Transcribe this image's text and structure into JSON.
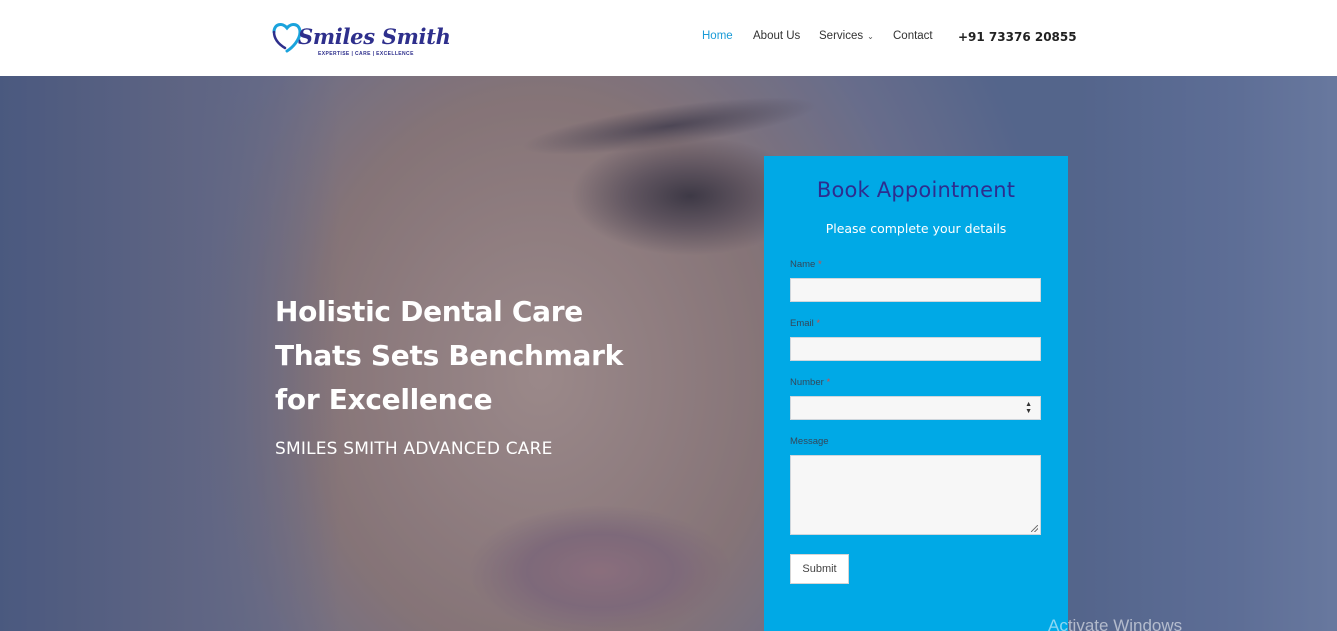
{
  "header": {
    "logo_name": "Smiles Smith",
    "logo_tagline": "EXPERTISE | CARE | EXCELLENCE",
    "nav": {
      "home": "Home",
      "about": "About Us",
      "services": "Services",
      "contact": "Contact"
    },
    "phone": "+91 73376 20855"
  },
  "hero": {
    "headline_line1": "Holistic Dental Care",
    "headline_line2": "Thats Sets Benchmark",
    "headline_line3": "for Excellence",
    "subheading": "SMILES SMITH ADVANCED CARE"
  },
  "form": {
    "title": "Book Appointment",
    "subtitle": "Please complete your details",
    "name_label": "Name",
    "email_label": "Email",
    "number_label": "Number",
    "message_label": "Message",
    "required_mark": "*",
    "name_value": "",
    "email_value": "",
    "number_value": "",
    "submit_label": "Submit"
  },
  "overlay": {
    "watermark": "Activate Windows"
  },
  "colors": {
    "brand_navy": "#2e2f8c",
    "accent_blue": "#00a9e6",
    "nav_active": "#1a9bd7",
    "required_red": "#e0453a"
  },
  "icons": {
    "logo_mark": "tooth-heart-icon",
    "services_caret": "chevron-down-icon",
    "number_spinner": "spinner-arrows-icon",
    "textarea_grip": "resize-grip-icon"
  }
}
